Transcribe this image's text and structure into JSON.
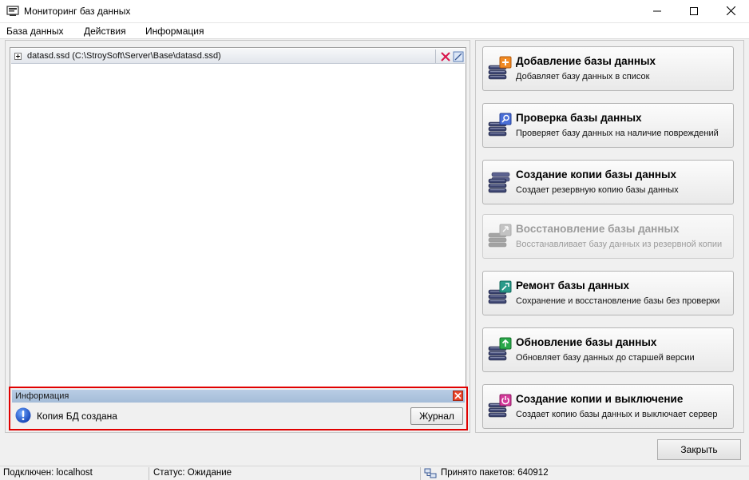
{
  "window": {
    "title": "Мониторинг баз данных",
    "icons": {
      "app": "monitor-app-icon",
      "minimize": "minimize-icon",
      "maximize": "maximize-icon",
      "close": "close-icon"
    }
  },
  "menu": {
    "items": [
      "База данных",
      "Действия",
      "Информация"
    ]
  },
  "tree": {
    "rows": [
      {
        "label": "datasd.ssd (C:\\StroySoft\\Server\\Base\\datasd.ssd)",
        "expander_icon": "plus-expander-icon",
        "delete_icon": "delete-x-icon",
        "edit_icon": "edit-icon"
      }
    ]
  },
  "info_panel": {
    "title": "Информация",
    "message": "Копия БД создана",
    "journal_label": "Журнал",
    "icon": "info-exclamation-icon",
    "close_icon": "close-x-icon"
  },
  "actions": [
    {
      "title": "Добавление базы данных",
      "description": "Добавляет базу данных в список",
      "icon": "database-add-icon",
      "accent": "#f08a24",
      "enabled": true
    },
    {
      "title": "Проверка базы данных",
      "description": "Проверяет базу данных на наличие повреждений",
      "icon": "database-check-icon",
      "accent": "#4a6fd8",
      "enabled": true
    },
    {
      "title": "Создание копии базы данных",
      "description": "Создает резервную копию базы данных",
      "icon": "database-backup-icon",
      "accent": "#5a5f8a",
      "enabled": true
    },
    {
      "title": "Восстановление базы данных",
      "description": "Восстанавливает базу данных из резервной копии",
      "icon": "database-restore-icon",
      "accent": "#9a9a9a",
      "enabled": false
    },
    {
      "title": "Ремонт базы данных",
      "description": "Сохранение и восстановление базы без проверки",
      "icon": "database-repair-icon",
      "accent": "#2a9a8a",
      "enabled": true
    },
    {
      "title": "Обновление базы данных",
      "description": "Обновляет базу данных до старшей версии",
      "icon": "database-update-icon",
      "accent": "#2aa84a",
      "enabled": true
    },
    {
      "title": "Создание копии и выключение",
      "description": "Создает копию базы данных и выключает сервер",
      "icon": "database-shutdown-icon",
      "accent": "#d43a9a",
      "enabled": true
    }
  ],
  "close_button": {
    "label": "Закрыть"
  },
  "status": {
    "connected": "Подключен: localhost",
    "state": "Статус: Ожидание",
    "packets": "Принято пакетов: 640912",
    "network_icon": "network-icon"
  },
  "colors": {
    "highlight_border": "#e00000",
    "info_header": "#a4bcd8"
  }
}
